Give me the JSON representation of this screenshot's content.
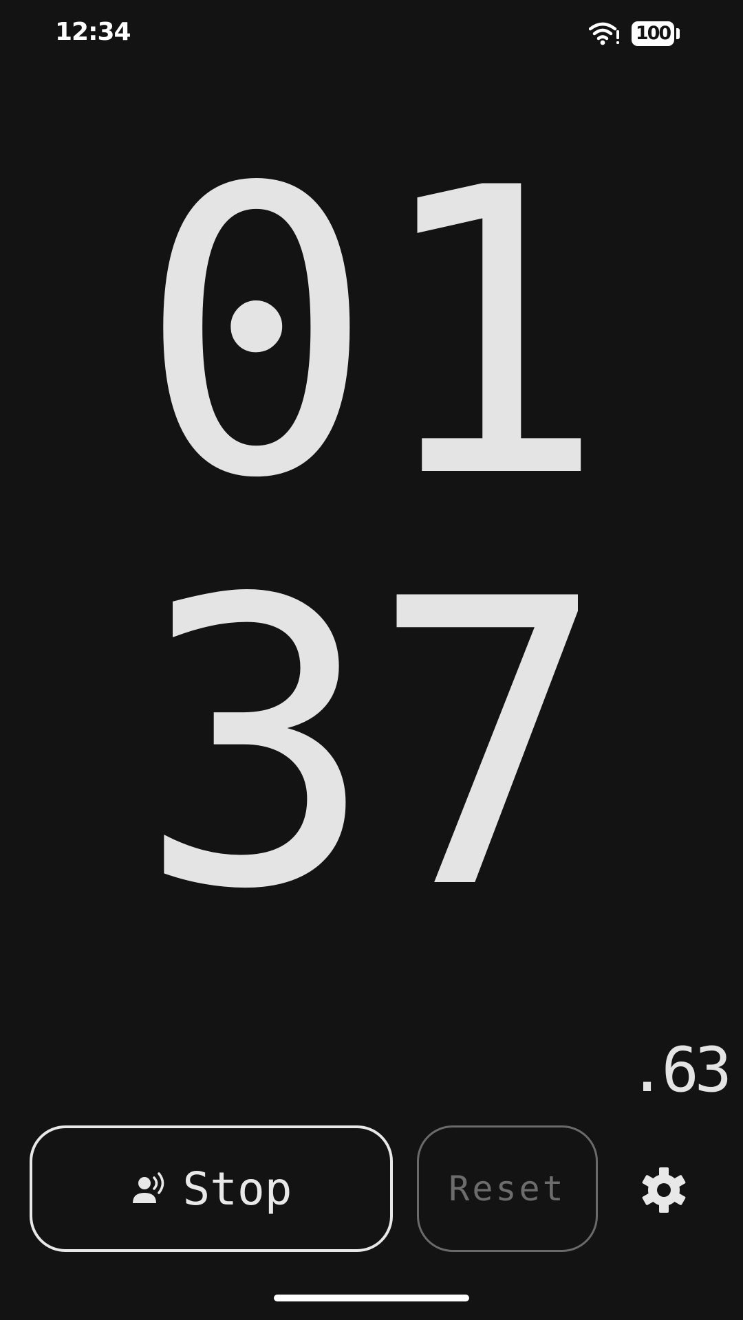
{
  "status_bar": {
    "time": "12:34",
    "battery_level": "100",
    "wifi_icon": "wifi-alert-icon"
  },
  "timer": {
    "minutes": "01",
    "seconds": "37",
    "fraction": ".63"
  },
  "controls": {
    "stop_label": "Stop",
    "stop_icon": "voice-person-icon",
    "reset_label": "Reset",
    "settings_icon": "gear-icon"
  },
  "colors": {
    "background": "#131313",
    "digits": "#e4e4e4",
    "disabled": "#6c6c6c"
  }
}
